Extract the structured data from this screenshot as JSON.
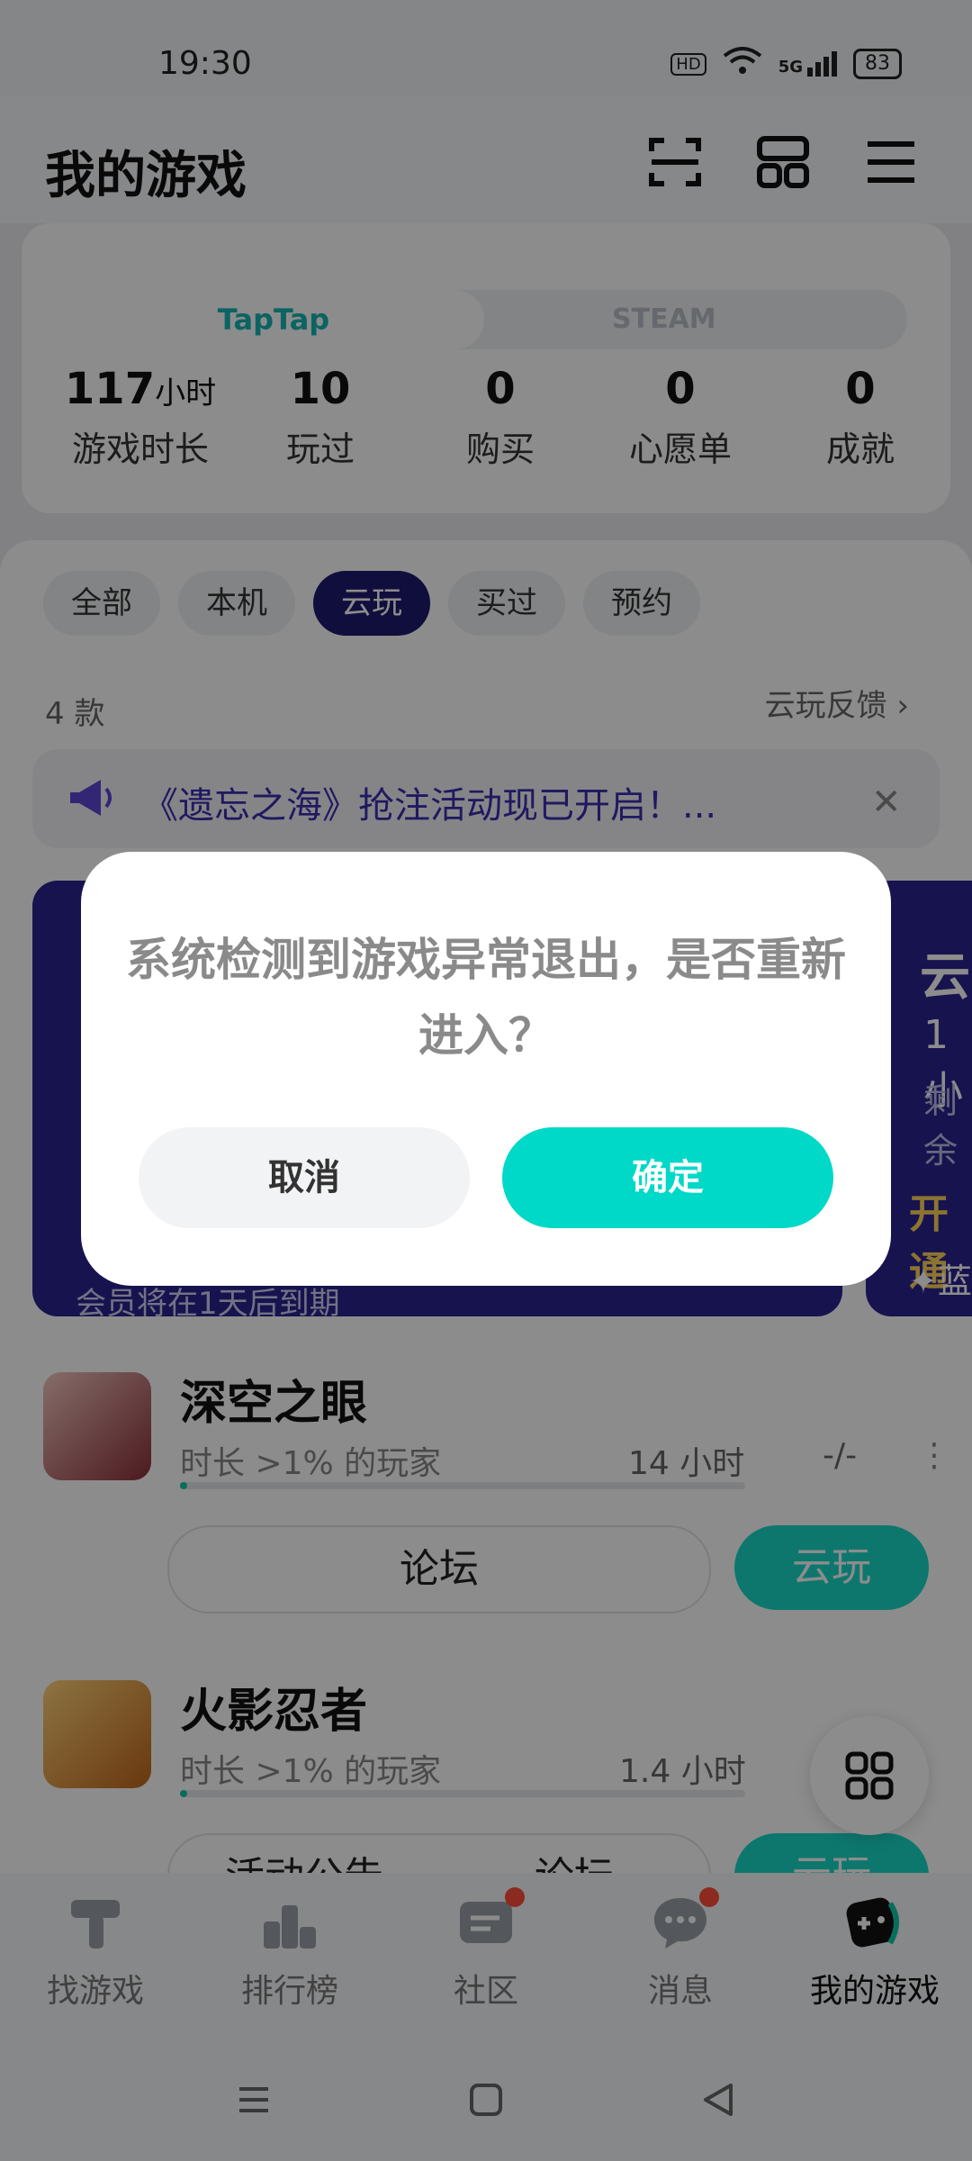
{
  "status_bar": {
    "time": "19:30",
    "hd": "HD",
    "network": "5G",
    "battery": "83"
  },
  "header": {
    "title": "我的游戏"
  },
  "profile": {
    "platforms": {
      "taptap": "TapTap",
      "steam": "STEAM"
    },
    "stats": [
      {
        "value": "117",
        "unit": "小时",
        "label": "游戏时长"
      },
      {
        "value": "10",
        "unit": "",
        "label": "玩过"
      },
      {
        "value": "0",
        "unit": "",
        "label": "购买"
      },
      {
        "value": "0",
        "unit": "",
        "label": "心愿单"
      },
      {
        "value": "0",
        "unit": "",
        "label": "成就"
      }
    ]
  },
  "filter_tabs": [
    "全部",
    "本机",
    "云玩",
    "买过",
    "预约"
  ],
  "active_tab": "云玩",
  "list_meta": {
    "count": "4 款",
    "feedback": "云玩反馈"
  },
  "announcement": {
    "text": "《遗忘之海》抢注活动现已开启！..."
  },
  "vip_card": {
    "expiry": "会员将在1天后到期"
  },
  "vip_card_2": {
    "title": "云",
    "line1": "1小",
    "line2": "剩余",
    "line3": "开通",
    "line4": "蓝"
  },
  "games": [
    {
      "name": "深空之眼",
      "percent_text": "时长 >1% 的玩家",
      "hours": "14 小时",
      "rating": "-/-",
      "progress": 0.01,
      "buttons": [
        "论坛",
        "云玩"
      ]
    },
    {
      "name": "火影忍者",
      "percent_text": "时长 >1% 的玩家",
      "hours": "1.4 小时",
      "rating": "",
      "progress": 0.01,
      "buttons": [
        "活动公告",
        "论坛",
        "云玩"
      ]
    }
  ],
  "bottom_nav": [
    {
      "label": "找游戏",
      "active": false,
      "badge": false
    },
    {
      "label": "排行榜",
      "active": false,
      "badge": false
    },
    {
      "label": "社区",
      "active": false,
      "badge": true
    },
    {
      "label": "消息",
      "active": false,
      "badge": true
    },
    {
      "label": "我的游戏",
      "active": true,
      "badge": false
    }
  ],
  "dialog": {
    "message": "系统检测到游戏异常退出，是否重新进入？",
    "cancel": "取消",
    "confirm": "确定"
  },
  "colors": {
    "accent": "#00d8c8",
    "tab_active": "#1e1a6e",
    "badge": "#ff4d3a"
  }
}
